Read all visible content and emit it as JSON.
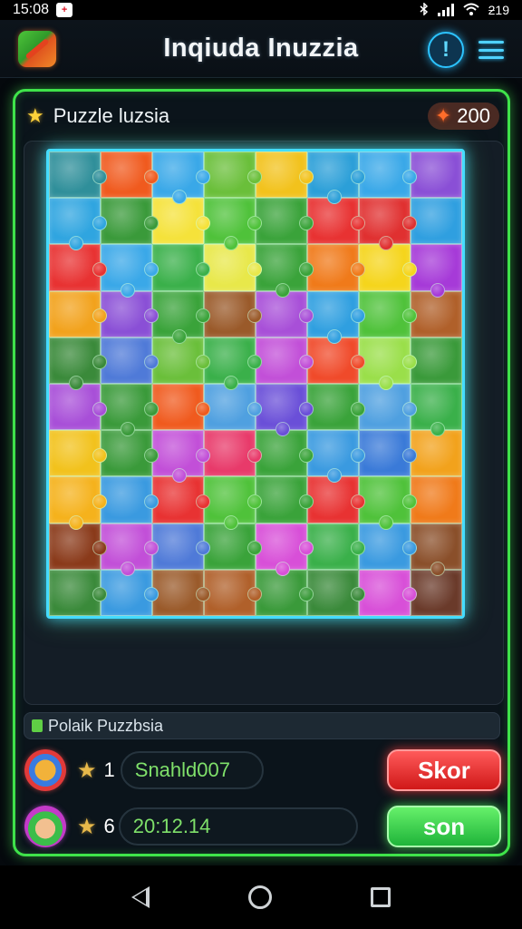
{
  "status_bar": {
    "time": "15:08",
    "app_icon_glyph": "+",
    "battery_text": "ƻ19"
  },
  "app_bar": {
    "title": "Inqiuda Inuzzia"
  },
  "panel": {
    "title": "Puzzle luzsia",
    "points": "200"
  },
  "board": {
    "columns": 8,
    "rows": 10,
    "colors": [
      "#2f8f9a",
      "#f05a1e",
      "#39a8e8",
      "#6abf3a",
      "#f2c21c",
      "#2b9fd8",
      "#39a8e8",
      "#8a4fd6",
      "#2fa5e0",
      "#3a9a3a",
      "#f5e23a",
      "#4fc23a",
      "#3aa33a",
      "#e83232",
      "#e03030",
      "#2f9fe0",
      "#e83232",
      "#3aa8e8",
      "#3ab04a",
      "#e8e84a",
      "#3aa33a",
      "#f07a1a",
      "#f5d51c",
      "#a63ad8",
      "#f2a21c",
      "#8a4fd6",
      "#3aa33a",
      "#9a5a2a",
      "#a84fd8",
      "#2f9fe0",
      "#4fc23a",
      "#b0602a",
      "#3a8a3a",
      "#4f7ad8",
      "#6abf3a",
      "#3ab04a",
      "#c24fd8",
      "#f04a2a",
      "#9adf4a",
      "#3a9a3a",
      "#a84fd8",
      "#3a9a3a",
      "#f05a1e",
      "#4fa0e0",
      "#6a4fd8",
      "#3aa33a",
      "#4fa0e0",
      "#3ab04a",
      "#f2c21c",
      "#3a9a3a",
      "#c24fd8",
      "#e83a6a",
      "#3aa33a",
      "#3a9ae0",
      "#3a7ad8",
      "#f2a21c",
      "#f5b21c",
      "#3a9ae0",
      "#e83232",
      "#4fc23a",
      "#3aa33a",
      "#e83232",
      "#4fc23a",
      "#f07a1a",
      "#8a3a1a",
      "#c24fd8",
      "#4f7ad8",
      "#3aa33a",
      "#d84fd8",
      "#3ab04a",
      "#3a9ae0",
      "#8a4f2a",
      "#3a8a3a",
      "#3a9ae0",
      "#9a5a2a",
      "#b0602a",
      "#3a9a3a",
      "#3a8a3a",
      "#d84fd8",
      "#6a3a2a"
    ]
  },
  "status_strip": {
    "text": "Polaik Puzzbsia"
  },
  "players": [
    {
      "rank": "1",
      "value": "Snahld007",
      "button": "Skor"
    },
    {
      "rank": "6",
      "value": "20:12.14",
      "button": "son"
    }
  ]
}
